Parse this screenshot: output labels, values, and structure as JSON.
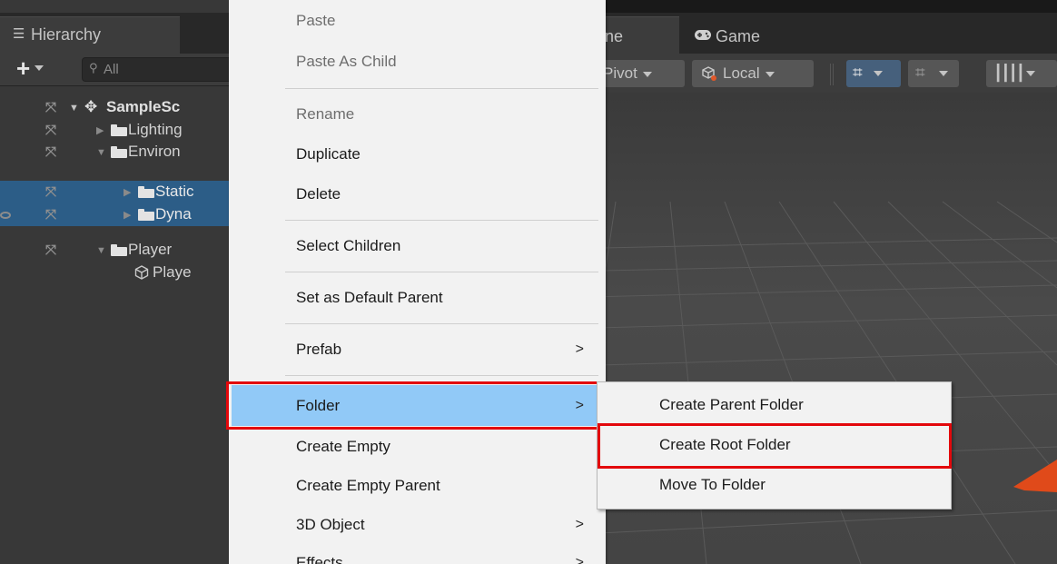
{
  "hierarchy": {
    "tab_label": "Hierarchy",
    "search_placeholder": "All",
    "rows": [
      {
        "label": "SampleSc"
      },
      {
        "label": "Lighting"
      },
      {
        "label": "Environ"
      },
      {
        "label": "Static"
      },
      {
        "label": "Dyna"
      },
      {
        "label": "Player"
      },
      {
        "label": "Playe"
      }
    ]
  },
  "scene": {
    "tab_scene_label": "ene",
    "tab_game_label": "Game",
    "pivot_label": "Pivot",
    "local_label": "Local"
  },
  "context_menu": {
    "items": [
      {
        "label": "Paste"
      },
      {
        "label": "Paste As Child"
      },
      {
        "label": "Rename"
      },
      {
        "label": "Duplicate"
      },
      {
        "label": "Delete"
      },
      {
        "label": "Select Children"
      },
      {
        "label": "Set as Default Parent"
      },
      {
        "label": "Prefab"
      },
      {
        "label": "Folder"
      },
      {
        "label": "Create Empty"
      },
      {
        "label": "Create Empty Parent"
      },
      {
        "label": "3D Object"
      },
      {
        "label": "Effects"
      }
    ],
    "submenu_arrow": ">"
  },
  "folder_submenu": {
    "items": [
      {
        "label": "Create Parent Folder"
      },
      {
        "label": "Create Root Folder"
      },
      {
        "label": "Move To Folder"
      }
    ]
  },
  "colors": {
    "menu_highlight": "#91c9f7",
    "annotation_frame": "#e3080c",
    "selection_row": "#2c5d87"
  }
}
